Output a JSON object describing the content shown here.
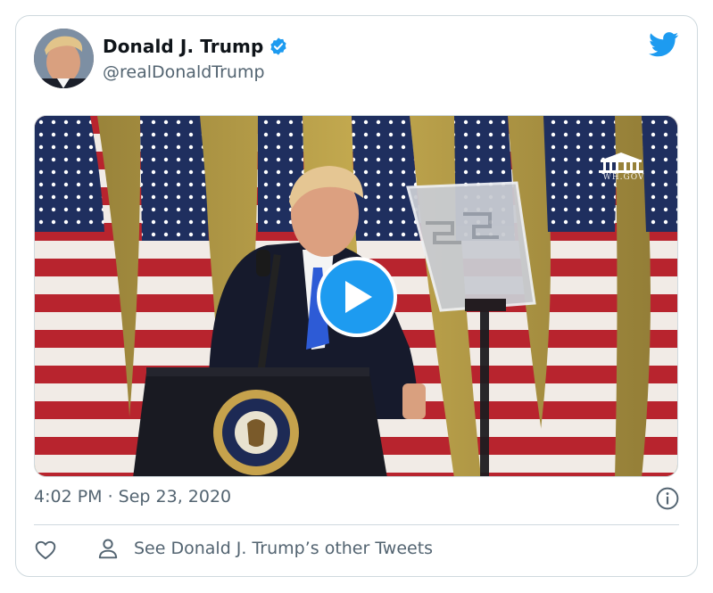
{
  "tweet": {
    "author": {
      "display_name": "Donald J. Trump",
      "handle": "@realDonaldTrump",
      "verified": true,
      "avatar": "profile-photo"
    },
    "media": {
      "type": "video",
      "watermark_icon": "white-house-icon",
      "watermark_text": "WH.GOV",
      "play_icon": "play-icon"
    },
    "timestamp": "4:02 PM · Sep 23, 2020",
    "actions": {
      "like_icon": "heart-icon",
      "info_icon": "info-icon",
      "other_tweets_icon": "person-icon",
      "other_tweets_label": "See Donald J. Trump’s other Tweets"
    }
  },
  "colors": {
    "brand_blue": "#1d9bf0",
    "text_primary": "#0f1419",
    "text_secondary": "#536471",
    "border": "#cfd9de"
  }
}
